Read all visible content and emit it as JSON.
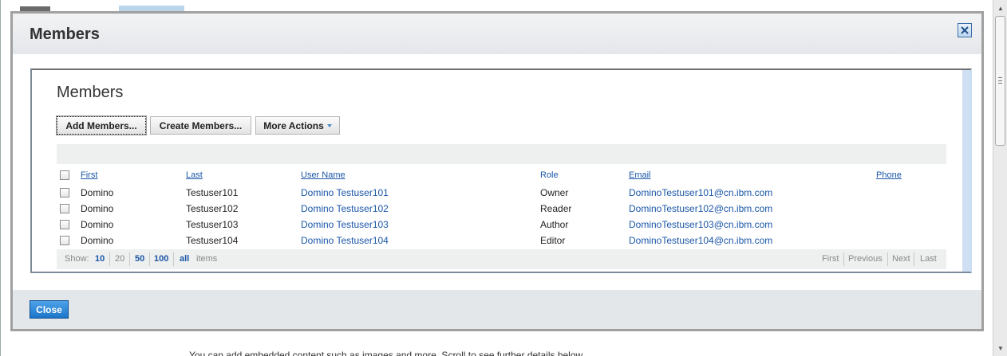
{
  "dialog": {
    "title": "Members",
    "close_button": "Close"
  },
  "panel": {
    "heading": "Members",
    "buttons": {
      "add": "Add Members...",
      "create": "Create Members...",
      "more": "More Actions"
    }
  },
  "table": {
    "headers": {
      "first": "First",
      "last": "Last",
      "user": "User Name",
      "role": "Role",
      "email": "Email",
      "phone": "Phone"
    },
    "rows": [
      {
        "first": "Domino",
        "last": "Testuser101",
        "user": "Domino Testuser101",
        "role": "Owner",
        "email": "DominoTestuser101@cn.ibm.com",
        "phone": ""
      },
      {
        "first": "Domino",
        "last": "Testuser102",
        "user": "Domino Testuser102",
        "role": "Reader",
        "email": "DominoTestuser102@cn.ibm.com",
        "phone": ""
      },
      {
        "first": "Domino",
        "last": "Testuser103",
        "user": "Domino Testuser103",
        "role": "Author",
        "email": "DominoTestuser103@cn.ibm.com",
        "phone": ""
      },
      {
        "first": "Domino",
        "last": "Testuser104",
        "user": "Domino Testuser104",
        "role": "Editor",
        "email": "DominoTestuser104@cn.ibm.com",
        "phone": ""
      }
    ]
  },
  "pager": {
    "show_label": "Show:",
    "sizes": [
      "10",
      "20",
      "50",
      "100",
      "all"
    ],
    "current_size": "20",
    "items_label": "items",
    "nav": {
      "first": "First",
      "previous": "Previous",
      "next": "Next",
      "last": "Last"
    }
  },
  "background": {
    "footer_text": "You can add embedded content such as images and more. Scroll to see further details below."
  },
  "colors": {
    "link": "#1a56a7",
    "close_button": "#1c75c9",
    "accent_edge": "#cfe0f4"
  }
}
